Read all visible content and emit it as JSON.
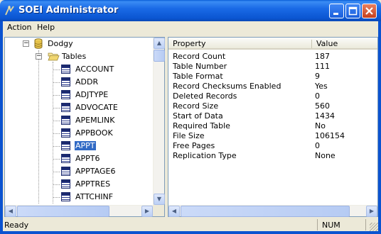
{
  "window": {
    "title": "SOEI Administrator",
    "accent": "#0b56d2"
  },
  "menu": {
    "items": [
      {
        "label": "Action"
      },
      {
        "label": "Help"
      }
    ]
  },
  "tree": {
    "database": "Dodgy",
    "tables_folder": "Tables",
    "tables": [
      "ACCOUNT",
      "ADDR",
      "ADJTYPE",
      "ADVOCATE",
      "APEMLINK",
      "APPBOOK",
      "APPT",
      "APPT6",
      "APPTAGE6",
      "APPTRES",
      "ATTCHINF"
    ],
    "selected": "APPT"
  },
  "list": {
    "columns": [
      "Property",
      "Value"
    ],
    "rows": [
      {
        "property": "Record Count",
        "value": "187"
      },
      {
        "property": "Table Number",
        "value": "111"
      },
      {
        "property": "Table Format",
        "value": "9"
      },
      {
        "property": "Record Checksums Enabled",
        "value": "Yes"
      },
      {
        "property": "Deleted Records",
        "value": "0"
      },
      {
        "property": "Record Size",
        "value": "560"
      },
      {
        "property": "Start of Data",
        "value": "1434"
      },
      {
        "property": "Required Table",
        "value": "No"
      },
      {
        "property": "File Size",
        "value": "106154"
      },
      {
        "property": "Free Pages",
        "value": "0"
      },
      {
        "property": "Replication Type",
        "value": "None"
      }
    ]
  },
  "status": {
    "text": "Ready",
    "num": "NUM"
  }
}
